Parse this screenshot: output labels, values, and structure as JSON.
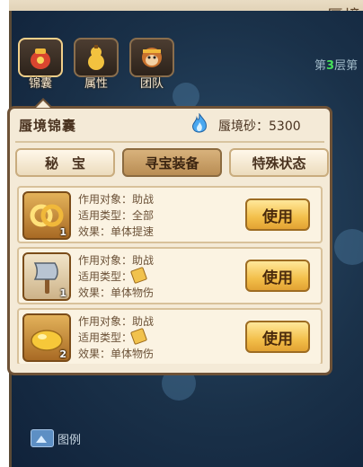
{
  "window": {
    "title": "蜃境"
  },
  "map": {
    "floor_prefix": "第",
    "floor_number": "3",
    "floor_suffix": "层第",
    "legend_label": "图例"
  },
  "top_tabs": [
    {
      "label": "锦囊",
      "icon": "pouch-icon"
    },
    {
      "label": "属性",
      "icon": "gourd-icon"
    },
    {
      "label": "团队",
      "icon": "monkey-icon"
    }
  ],
  "panel": {
    "title": "蜃境锦囊",
    "sand_label": "蜃境砂：5300",
    "sand_icon": "blue-flame-icon",
    "subtabs": [
      {
        "label": "秘　宝",
        "active": false
      },
      {
        "label": "寻宝装备",
        "active": true
      },
      {
        "label": "特殊状态",
        "active": false
      }
    ],
    "items": [
      {
        "icon": "gold-rings-icon",
        "count": "1",
        "target": "作用对象：助战",
        "type": "适用类型：全部",
        "effect": "效果：单体提速",
        "button": "使用"
      },
      {
        "icon": "axe-icon",
        "count": "1",
        "target": "作用对象：助战",
        "type": "适用类型：",
        "effect": "效果：单体物伤",
        "button": "使用"
      },
      {
        "icon": "gold-nugget-icon",
        "count": "2",
        "target": "作用对象：助战",
        "type": "适用类型：",
        "effect": "效果：单体物伤",
        "button": "使用"
      }
    ]
  },
  "colors": {
    "accent": "#f3bf4a",
    "panel_bg": "#f4ead7",
    "floor_number": "#46e05a"
  }
}
